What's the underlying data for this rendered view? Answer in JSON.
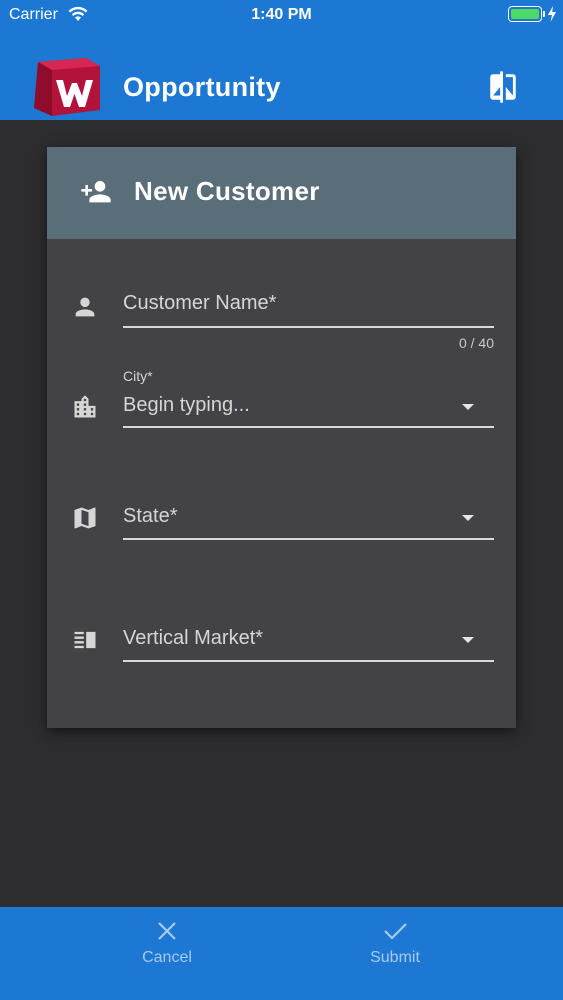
{
  "status_bar": {
    "carrier": "Carrier",
    "time": "1:40 PM",
    "battery_color": "#4cd964"
  },
  "app_bar": {
    "title": "Opportunity",
    "logo_letter": "W",
    "background_color": "#1c78d3",
    "action_icon": "compare-icon"
  },
  "card": {
    "title": "New Customer",
    "header_icon": "person-add-icon",
    "header_color": "#5a6e79",
    "fields": {
      "customer_name": {
        "placeholder": "Customer Name*",
        "counter": "0 / 40",
        "icon": "person-icon"
      },
      "city": {
        "label": "City*",
        "placeholder": "Begin typing...",
        "icon": "city-icon"
      },
      "state": {
        "placeholder": "State*",
        "icon": "map-icon"
      },
      "vertical_market": {
        "placeholder": "Vertical Market*",
        "icon": "vertical-split-icon"
      }
    }
  },
  "bottom_bar": {
    "cancel_label": "Cancel",
    "submit_label": "Submit",
    "cancel_icon": "close-icon",
    "submit_icon": "check-icon"
  }
}
